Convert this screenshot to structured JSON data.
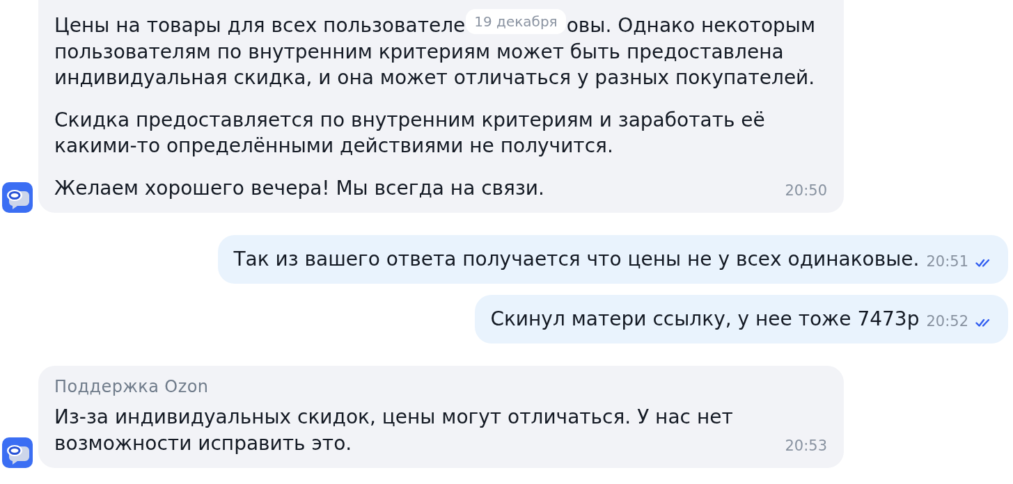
{
  "messages": [
    {
      "kind": "incoming",
      "paragraphs": [
        {
          "segments": [
            {
              "kind": "fragment",
              "text": "Цены на товары для всех пользователе"
            },
            {
              "kind": "date",
              "text": "19 декабря"
            },
            {
              "kind": "fragment",
              "text": "овы. Однако некоторым"
            },
            {
              "kind": "text",
              "text": "пользователям по внутренним критериям может быть предоставлена индивидуальная скидка, и она может отличаться у разных покупателей."
            }
          ]
        },
        {
          "segments": [
            {
              "kind": "text",
              "text": "Скидка предоставляется по внутренним критериям и заработать её какими-то определёнными действиями не получится."
            }
          ]
        },
        {
          "segments": [
            {
              "kind": "text",
              "text": "Желаем хорошего вечера! Мы всегда на связи."
            }
          ]
        }
      ],
      "time": "20:50"
    },
    {
      "kind": "outgoing",
      "paragraphs": [
        {
          "segments": [
            {
              "kind": "text",
              "text": "Так из вашего ответа получается что цены не у всех одинаковые."
            }
          ]
        }
      ],
      "time": "20:51",
      "read": true
    },
    {
      "kind": "outgoing",
      "paragraphs": [
        {
          "segments": [
            {
              "kind": "text",
              "text": "Скинул матери ссылку, у нее тоже 7473р"
            }
          ]
        }
      ],
      "time": "20:52",
      "read": true
    },
    {
      "kind": "incoming",
      "sender": "Поддержка Ozon",
      "paragraphs": [
        {
          "segments": [
            {
              "kind": "text",
              "text": "Из-за индивидуальных скидок, цены могут отличаться. У нас нет возможности исправить это."
            }
          ]
        }
      ],
      "time": "20:53"
    }
  ]
}
